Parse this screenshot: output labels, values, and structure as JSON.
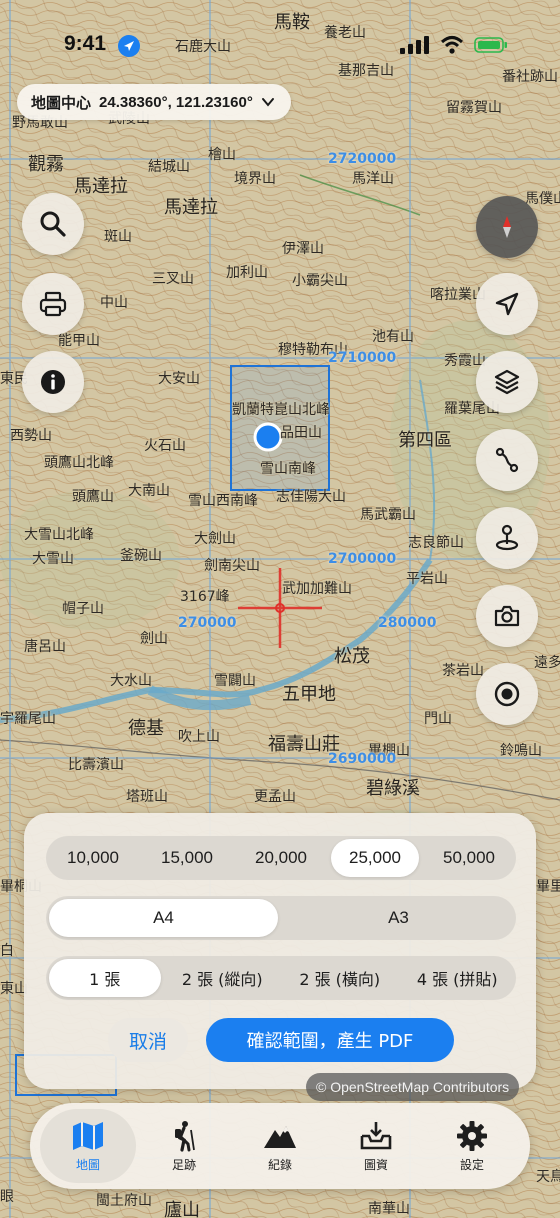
{
  "status_bar": {
    "time": "9:41"
  },
  "map_center": {
    "label": "地圖中心",
    "coords": "24.38360°, 121.23160°"
  },
  "map": {
    "places": [
      {
        "name": "石鹿大山"
      },
      {
        "name": "馬鞍"
      },
      {
        "name": "養老山"
      },
      {
        "name": "基那吉山"
      },
      {
        "name": "番社跡山"
      },
      {
        "name": "留霧賀山"
      },
      {
        "name": "野馬敢山"
      },
      {
        "name": "武陵山"
      },
      {
        "name": "觀霧"
      },
      {
        "name": "馬達拉"
      },
      {
        "name": "結城山"
      },
      {
        "name": "檜山"
      },
      {
        "name": "境界山"
      },
      {
        "name": "馬洋山"
      },
      {
        "name": "馬達拉"
      },
      {
        "name": "馬僕山"
      },
      {
        "name": "斑山"
      },
      {
        "name": "伊澤山"
      },
      {
        "name": "三叉山"
      },
      {
        "name": "加利山"
      },
      {
        "name": "小霸尖山"
      },
      {
        "name": "喀拉業山"
      },
      {
        "name": "中山"
      },
      {
        "name": "能甲山"
      },
      {
        "name": "池有山"
      },
      {
        "name": "穆特勒布山"
      },
      {
        "name": "秀霞山"
      },
      {
        "name": "東民"
      },
      {
        "name": "大安山"
      },
      {
        "name": "凱蘭特崑山北峰"
      },
      {
        "name": "羅葉尾山"
      },
      {
        "name": "西勢山"
      },
      {
        "name": "火石山"
      },
      {
        "name": "品田山"
      },
      {
        "name": "第四區"
      },
      {
        "name": "頭鷹山北峰"
      },
      {
        "name": "雪山南峰"
      },
      {
        "name": "頭鷹山"
      },
      {
        "name": "大南山"
      },
      {
        "name": "雪山西南峰"
      },
      {
        "name": "志佳陽大山"
      },
      {
        "name": "馬武霸山"
      },
      {
        "name": "大雪山北峰"
      },
      {
        "name": "大劍山"
      },
      {
        "name": "志良節山"
      },
      {
        "name": "大雪山"
      },
      {
        "name": "釜碗山"
      },
      {
        "name": "劍南尖山"
      },
      {
        "name": "平岩山"
      },
      {
        "name": "3167峰"
      },
      {
        "name": "武加加難山"
      },
      {
        "name": "帽子山"
      },
      {
        "name": "劍山"
      },
      {
        "name": "唐呂山"
      },
      {
        "name": "松茂"
      },
      {
        "name": "茶岩山"
      },
      {
        "name": "遠多"
      },
      {
        "name": "大水山"
      },
      {
        "name": "雪闢山"
      },
      {
        "name": "五甲地"
      },
      {
        "name": "宇羅尾山"
      },
      {
        "name": "德基"
      },
      {
        "name": "吹上山"
      },
      {
        "name": "門山"
      },
      {
        "name": "福壽山莊"
      },
      {
        "name": "畢棚山"
      },
      {
        "name": "鈴鳴山"
      },
      {
        "name": "比壽濱山"
      },
      {
        "name": "碧綠溪"
      },
      {
        "name": "塔班山"
      },
      {
        "name": "更孟山"
      },
      {
        "name": "畢里"
      },
      {
        "name": "畢桐山"
      },
      {
        "name": "白"
      },
      {
        "name": "東山"
      },
      {
        "name": "天鳥"
      },
      {
        "name": "廬山"
      },
      {
        "name": "南華山"
      },
      {
        "name": "眼"
      },
      {
        "name": "閩土府山"
      }
    ],
    "grid_labels": [
      "2720000",
      "2710000",
      "2700000",
      "2690000",
      "270000",
      "280000"
    ]
  },
  "fabs": {
    "left": [
      "search-icon",
      "print-icon",
      "info-icon"
    ],
    "right": [
      "compass-icon",
      "locate-icon",
      "layers-icon",
      "route-icon",
      "pin-icon",
      "camera-icon",
      "record-icon"
    ]
  },
  "panel": {
    "scales": [
      "10,000",
      "15,000",
      "20,000",
      "25,000",
      "50,000"
    ],
    "scale_selected": "25,000",
    "paper_sizes": [
      "A4",
      "A3"
    ],
    "paper_selected": "A4",
    "sheets": [
      "1 張",
      "2 張 (縱向)",
      "2 張 (橫向)",
      "4 張 (拼貼)"
    ],
    "sheets_selected": "1 張",
    "cancel_label": "取消",
    "confirm_label": "確認範圍，產生 PDF"
  },
  "attribution": "© OpenStreetMap Contributors",
  "tabs": [
    {
      "label": "地圖",
      "icon": "map-icon",
      "selected": true
    },
    {
      "label": "足跡",
      "icon": "hiker-icon",
      "selected": false
    },
    {
      "label": "紀錄",
      "icon": "mountain-icon",
      "selected": false
    },
    {
      "label": "圖資",
      "icon": "download-tray-icon",
      "selected": false
    },
    {
      "label": "設定",
      "icon": "gear-icon",
      "selected": false
    }
  ],
  "colors": {
    "accent": "#1b7ff0",
    "map_base": "#cfc2a0",
    "contour": "#b07a46",
    "grid_line": "#6fa6da",
    "river": "#6aa9c9",
    "crosshair": "#e0302a"
  }
}
